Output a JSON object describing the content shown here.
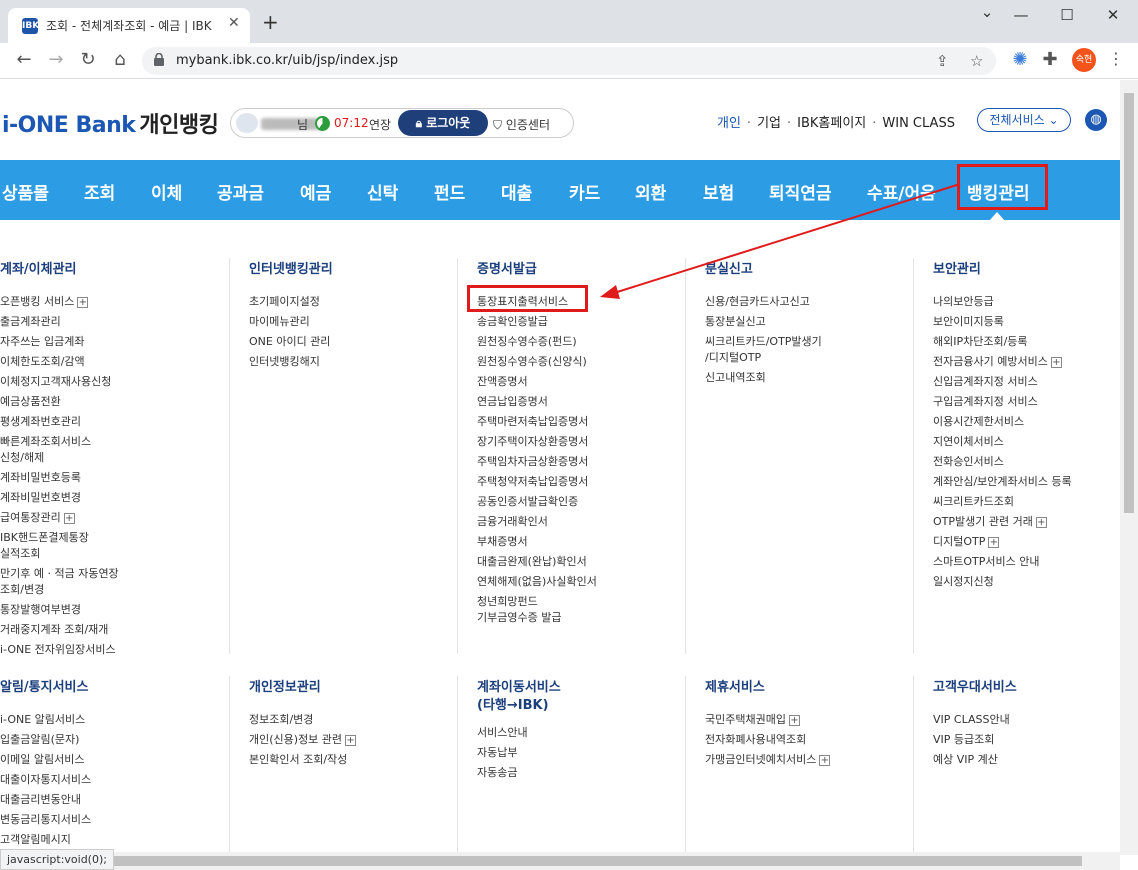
{
  "browser": {
    "tab_title": "조회 - 전체계좌조회 - 예금 | IBK",
    "tab_favicon": "IBK",
    "url": "mybank.ibk.co.kr/uib/jsp/index.jsp",
    "profile_label": "숙현",
    "status_text": "javascript:void(0);"
  },
  "header": {
    "logo_prefix": "i-ONE Bank",
    "logo_suffix": "개인뱅킹",
    "user_suffix": "님",
    "timer": "07:12",
    "extend": "연장",
    "logout": "로그아웃",
    "cert_center": "인증센터",
    "top_links": [
      "개인",
      "기업",
      "IBK홈페이지",
      "WIN CLASS"
    ],
    "all_services": "전체서비스"
  },
  "gnb": [
    "상품몰",
    "조회",
    "이체",
    "공과금",
    "예금",
    "신탁",
    "펀드",
    "대출",
    "카드",
    "외환",
    "보험",
    "퇴직연금",
    "수표/어음",
    "뱅킹관리"
  ],
  "menu": [
    {
      "title": "계좌/이체관리",
      "items": [
        "오픈뱅킹 서비스",
        "출금계좌관리",
        "자주쓰는 입금계좌",
        "이체한도조회/감액",
        "이체정지고객재사용신청",
        "예금상품전환",
        "평생계좌번호관리",
        "빠른계좌조회서비스",
        "신청/해제",
        "계좌비밀번호등록",
        "계좌비밀번호변경",
        "급여통장관리",
        "IBK핸드폰결제통장",
        "실적조회",
        "만기후 예 · 적금 자동연장",
        "조회/변경",
        "통장발행여부변경",
        "거래중지계좌 조회/재개",
        "i-ONE 전자위임장서비스"
      ]
    },
    {
      "title": "인터넷뱅킹관리",
      "items": [
        "초기페이지설정",
        "마이메뉴관리",
        "ONE 아이디 관리",
        "인터넷뱅킹해지"
      ]
    },
    {
      "title": "증명서발급",
      "items": [
        "통장표지출력서비스",
        "송금확인증발급",
        "원천징수영수증(펀드)",
        "원천징수영수증(신양식)",
        "잔액증명서",
        "연금납입증명서",
        "주택마련저축납입증명서",
        "장기주택이자상환증명서",
        "주택임차자금상환증명서",
        "주택청약저축납입증명서",
        "공동인증서발급확인증",
        "금융거래확인서",
        "부채증명서",
        "대출금완제(완납)확인서",
        "연체해제(없음)사실확인서",
        "청년희망펀드",
        "기부금영수증 발급"
      ]
    },
    {
      "title": "분실신고",
      "items": [
        "신용/현금카드사고신고",
        "통장분실신고",
        "씨크리트카드/OTP발생기",
        "/디지털OTP",
        "신고내역조회"
      ]
    },
    {
      "title": "보안관리",
      "items": [
        "나의보안등급",
        "보안이미지등록",
        "해외IP차단조회/등록",
        "전자금융사기 예방서비스",
        "신입금계좌지정 서비스",
        "구입금계좌지정 서비스",
        "이용시간제한서비스",
        "지연이체서비스",
        "전화승인서비스",
        "계좌안심/보안계좌서비스 등록",
        "씨크리트카드조회",
        "OTP발생기 관련 거래",
        "디지털OTP",
        "스마트OTP서비스 안내",
        "일시정지신청"
      ]
    },
    {
      "title": "알림/통지서비스",
      "items": [
        "i-ONE 알림서비스",
        "입출금알림(문자)",
        "이메일 알림서비스",
        "대출이자통지서비스",
        "대출금리변동안내",
        "변동금리통지서비스",
        "고객알림메시지"
      ]
    },
    {
      "title": "개인정보관리",
      "items": [
        "정보조회/변경",
        "개인(신용)정보 관련",
        "본인확인서 조회/작성"
      ]
    },
    {
      "title": "계좌이동서비스",
      "title2": "(타행→IBK)",
      "items": [
        "서비스안내",
        "자동납부",
        "자동송금"
      ]
    },
    {
      "title": "제휴서비스",
      "items": [
        "국민주택채권매입",
        "전자화폐사용내역조회",
        "가맹금인터넷예치서비스"
      ]
    },
    {
      "title": "고객우대서비스",
      "items": [
        "VIP CLASS안내",
        "VIP 등급조회",
        "예상 VIP 계산"
      ]
    }
  ],
  "colors": {
    "gnb": "#2c9ce5",
    "highlight": "#e01b1b",
    "heading": "#1b3f7d",
    "brand": "#1b57b3"
  }
}
